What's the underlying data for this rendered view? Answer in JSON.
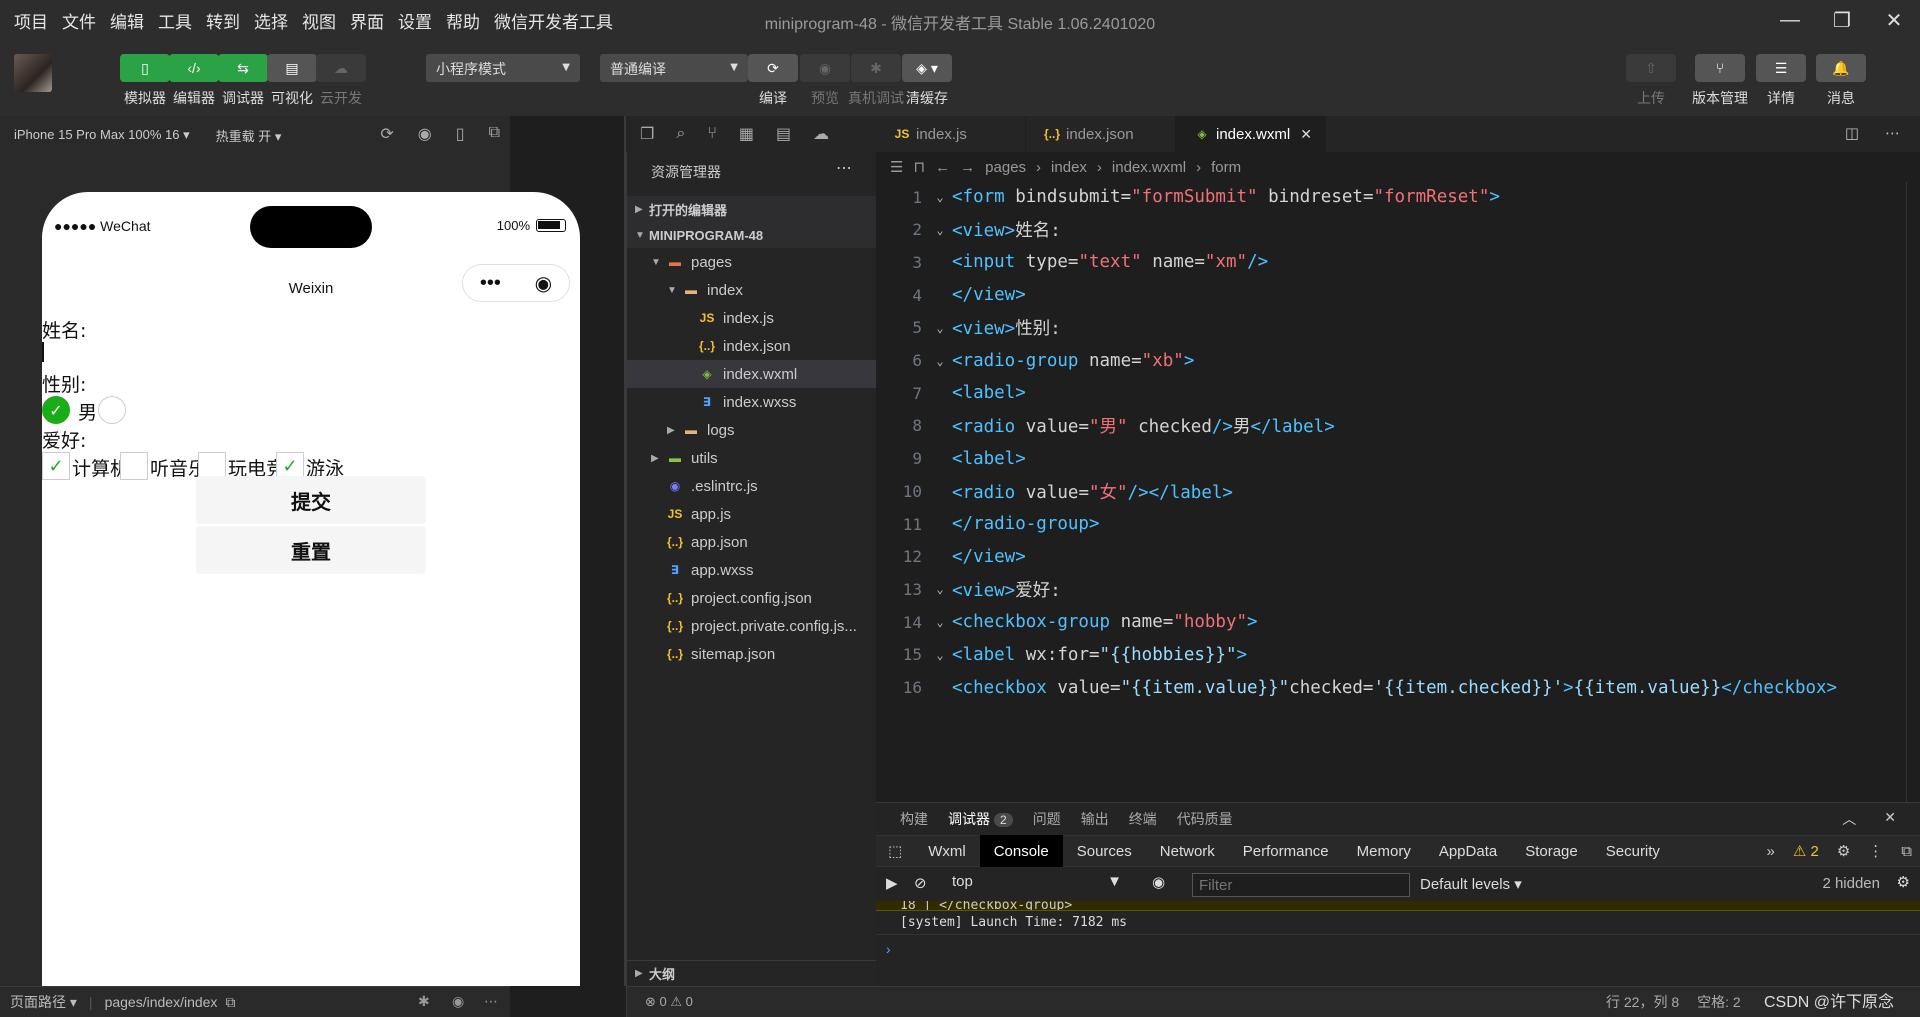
{
  "menubar": {
    "items": [
      "项目",
      "文件",
      "编辑",
      "工具",
      "转到",
      "选择",
      "视图",
      "界面",
      "设置",
      "帮助",
      "微信开发者工具"
    ],
    "title": "miniprogram-48 - 微信开发者工具 Stable 1.06.2401020"
  },
  "toolbar": {
    "left_buttons": [
      {
        "label": "模拟器",
        "icon": "phone-icon"
      },
      {
        "label": "编辑器",
        "icon": "code-icon"
      },
      {
        "label": "调试器",
        "icon": "debug-icon"
      },
      {
        "label": "可视化",
        "icon": "layout-icon"
      },
      {
        "label": "云开发",
        "icon": "cloud-icon"
      }
    ],
    "mode_select": "小程序模式",
    "compile_select": "普通编译",
    "mid_buttons": [
      {
        "label": "编译",
        "icon": "refresh-icon"
      },
      {
        "label": "预览",
        "icon": "eye-icon"
      },
      {
        "label": "真机调试",
        "icon": "bug-icon"
      },
      {
        "label": "清缓存",
        "icon": "layers-icon"
      }
    ],
    "right_buttons": [
      {
        "label": "上传",
        "icon": "upload-icon"
      },
      {
        "label": "版本管理",
        "icon": "branch-icon"
      },
      {
        "label": "详情",
        "icon": "menu-icon"
      },
      {
        "label": "消息",
        "icon": "bell-icon"
      }
    ]
  },
  "simulator": {
    "device": "iPhone 15 Pro Max 100% 16",
    "hot_reload": "热重载 开",
    "status_carrier": "●●●●● WeChat",
    "status_battery": "100%",
    "nav_title": "Weixin",
    "form": {
      "name_label": "姓名:",
      "gender_label": "性别:",
      "gender_male": "男",
      "hobby_label": "爱好:",
      "hobbies": [
        {
          "label": "计算机",
          "checked": true
        },
        {
          "label": "听音乐",
          "checked": false
        },
        {
          "label": "玩电竞",
          "checked": false
        },
        {
          "label": "游泳",
          "checked": true
        }
      ],
      "submit": "提交",
      "reset": "重置"
    },
    "footer_path_label": "页面路径",
    "footer_path": "pages/index/index"
  },
  "explorer": {
    "title": "资源管理器",
    "open_editors": "打开的编辑器",
    "project": "MINIPROGRAM-48",
    "tree": [
      {
        "name": "pages",
        "type": "folder-red",
        "depth": 1,
        "twisty": "▼"
      },
      {
        "name": "index",
        "type": "folder",
        "depth": 2,
        "twisty": "▼"
      },
      {
        "name": "index.js",
        "type": "js",
        "depth": 3
      },
      {
        "name": "index.json",
        "type": "json",
        "depth": 3
      },
      {
        "name": "index.wxml",
        "type": "wxml",
        "depth": 3,
        "selected": true
      },
      {
        "name": "index.wxss",
        "type": "wxss",
        "depth": 3
      },
      {
        "name": "logs",
        "type": "folder",
        "depth": 2,
        "twisty": "▶"
      },
      {
        "name": "utils",
        "type": "folder-green",
        "depth": 1,
        "twisty": "▶"
      },
      {
        "name": ".eslintrc.js",
        "type": "eslint",
        "depth": 1
      },
      {
        "name": "app.js",
        "type": "js",
        "depth": 1
      },
      {
        "name": "app.json",
        "type": "json",
        "depth": 1
      },
      {
        "name": "app.wxss",
        "type": "wxss",
        "depth": 1
      },
      {
        "name": "project.config.json",
        "type": "json",
        "depth": 1
      },
      {
        "name": "project.private.config.js...",
        "type": "json",
        "depth": 1
      },
      {
        "name": "sitemap.json",
        "type": "json",
        "depth": 1
      }
    ],
    "outline": "大纲",
    "errors": "⊗ 0 ⚠ 0"
  },
  "editor": {
    "tabs": [
      {
        "label": "index.js",
        "type": "js"
      },
      {
        "label": "index.json",
        "type": "json"
      },
      {
        "label": "index.wxml",
        "type": "wxml",
        "active": true
      }
    ],
    "breadcrumb": [
      "pages",
      "index",
      "index.wxml",
      "form"
    ],
    "lines": [
      {
        "n": "1",
        "fold": true,
        "html": "<span class='tok-tag'>&lt;form</span> <span class='tok-attr'>bindsubmit=</span><span class='tok-str'>\"formSubmit\"</span> <span class='tok-attr'>bindreset=</span><span class='tok-str'>\"formReset\"</span><span class='tok-tag'>&gt;</span>"
      },
      {
        "n": "2",
        "fold": true,
        "html": "<span class='tok-tag'>&lt;view&gt;</span><span class='tok-text'>姓名:</span>"
      },
      {
        "n": "3",
        "fold": false,
        "html": "<span class='tok-tag'>&lt;input</span> <span class='tok-attr'>type=</span><span class='tok-str'>\"text\"</span> <span class='tok-attr'>name=</span><span class='tok-str'>\"xm\"</span><span class='tok-tag'>/&gt;</span>"
      },
      {
        "n": "4",
        "fold": false,
        "html": "<span class='tok-tag'>&lt;/view&gt;</span>"
      },
      {
        "n": "5",
        "fold": true,
        "html": "<span class='tok-tag'>&lt;view&gt;</span><span class='tok-text'>性别:</span>"
      },
      {
        "n": "6",
        "fold": true,
        "html": "<span class='tok-tag'>&lt;radio-group</span> <span class='tok-attr'>name=</span><span class='tok-str'>\"xb\"</span><span class='tok-tag'>&gt;</span>"
      },
      {
        "n": "7",
        "fold": false,
        "html": "<span class='tok-tag'>&lt;label&gt;</span>"
      },
      {
        "n": "8",
        "fold": false,
        "html": "<span class='tok-tag'>&lt;radio</span> <span class='tok-attr'>value=</span><span class='tok-str'>\"男\"</span> <span class='tok-attr'>checked</span><span class='tok-tag'>/&gt;</span><span class='tok-text'>男</span><span class='tok-tag'>&lt;/label&gt;</span>"
      },
      {
        "n": "9",
        "fold": false,
        "html": "<span class='tok-tag'>&lt;label&gt;</span>"
      },
      {
        "n": "10",
        "fold": false,
        "html": "<span class='tok-tag'>&lt;radio</span> <span class='tok-attr'>value=</span><span class='tok-str'>\"女\"</span><span class='tok-tag'>/&gt;&lt;/label&gt;</span>"
      },
      {
        "n": "11",
        "fold": false,
        "html": "<span class='tok-tag'>&lt;/radio-group&gt;</span>"
      },
      {
        "n": "12",
        "fold": false,
        "html": "<span class='tok-tag'>&lt;/view&gt;</span>"
      },
      {
        "n": "13",
        "fold": true,
        "html": "<span class='tok-tag'>&lt;view&gt;</span><span class='tok-text'>爱好:</span>"
      },
      {
        "n": "14",
        "fold": true,
        "html": "<span class='tok-tag'>&lt;checkbox-group</span> <span class='tok-attr'>name=</span><span class='tok-str'>\"hobby\"</span><span class='tok-tag'>&gt;</span>"
      },
      {
        "n": "15",
        "fold": true,
        "html": "<span class='tok-tag'>&lt;label</span> <span class='tok-attr'>wx:for=</span><span class='tok-brace'>\"{{hobbies}}\"</span><span class='tok-tag'>&gt;</span>"
      },
      {
        "n": "16",
        "fold": false,
        "html": "<span class='tok-tag'>&lt;checkbox</span> <span class='tok-attr'>value=</span><span class='tok-brace'>\"{{item.value}}\"</span><span class='tok-attr'>checked=</span><span class='tok-brace'>'{{item.checked}}'</span><span class='tok-tag'>&gt;</span><span class='tok-brace'>{{item.value}}</span><span class='tok-tag'>&lt;/checkbox&gt;</span>"
      }
    ]
  },
  "panel": {
    "tabs": [
      {
        "label": "构建"
      },
      {
        "label": "调试器",
        "badge": "2",
        "active": true
      },
      {
        "label": "问题"
      },
      {
        "label": "输出"
      },
      {
        "label": "终端"
      },
      {
        "label": "代码质量"
      }
    ],
    "devtabs": [
      "Wxml",
      "Console",
      "Sources",
      "Network",
      "Performance",
      "Memory",
      "AppData",
      "Storage",
      "Security"
    ],
    "active_devtab": "Console",
    "warnings": "2",
    "context": "top",
    "filter_placeholder": "Filter",
    "levels": "Default levels ▾",
    "hidden": "2 hidden",
    "console_lines": [
      "18 | </checkbox-group>",
      "[system] Launch Time: 7182 ms"
    ]
  },
  "status": {
    "position": "行 22，列 8",
    "spaces": "空格: 2",
    "watermark": "CSDN @许下原念"
  }
}
